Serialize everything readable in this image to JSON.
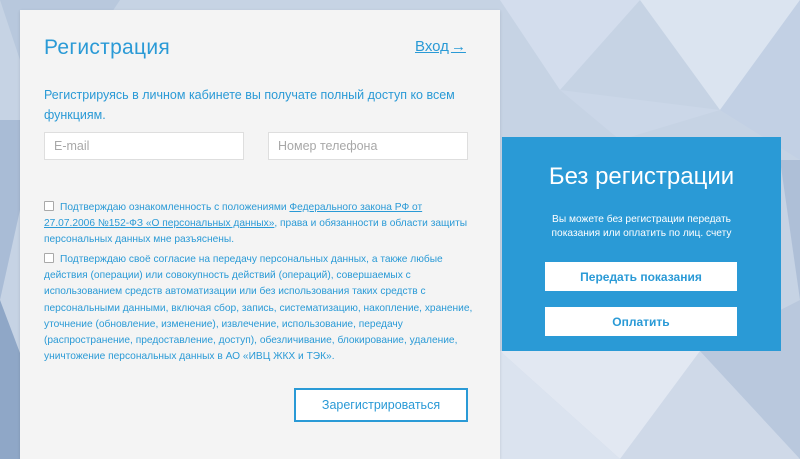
{
  "registration": {
    "title": "Регистрация",
    "login_link": "Вход",
    "login_arrow": "→",
    "description": "Регистрируясь в личном кабинете вы получате полный доступ ко всем функциям.",
    "email_placeholder": "E-mail",
    "phone_placeholder": "Номер телефона",
    "consent_1": {
      "text_before": "Подтверждаю ознакомленность с положениями ",
      "link": "Федерального закона РФ от 27.07.2006 №152-ФЗ «О персональных данных»",
      "text_after": ", права и обязанности в области защиты персональных данных мне разъяснены."
    },
    "consent_2": {
      "text": "Подтверждаю своё согласие на передачу персональных данных, а также любые действия (операции) или совокупность действий (операций), совершаемых с использованием средств автоматизации или без использования таких средств с персональными данными, включая сбор, запись, систематизацию, накопление, хранение, уточнение (обновление, изменение), извлечение, использование, передачу (распространение, предоставление, доступ), обезличивание, блокирование, удаление, уничтожение персональных данных в АО «ИВЦ ЖКХ и ТЭК»."
    },
    "register_button": "Зарегистрироваться"
  },
  "guest": {
    "title": "Без регистрации",
    "description": "Вы можете без регистрации передать показания или оплатить по лиц. счету",
    "readings_button": "Передать показания",
    "pay_button": "Оплатить"
  },
  "colors": {
    "accent": "#2a9ad6",
    "card_bg": "#f4f4f4",
    "page_bg": "#c9d6e6"
  },
  "icons": {
    "login_arrow": "arrow-right-icon",
    "checkbox": "checkbox-unchecked-icon"
  }
}
